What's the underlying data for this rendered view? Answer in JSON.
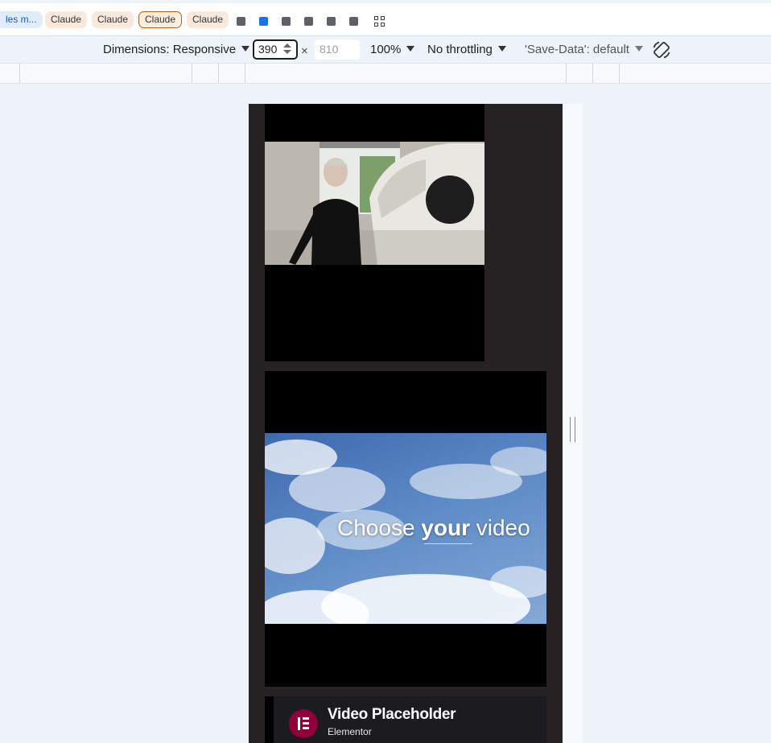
{
  "tabbar": {
    "chips": [
      {
        "label": "les m...",
        "style": "blue"
      },
      {
        "label": "Claude",
        "style": "peach"
      },
      {
        "label": "Claude",
        "style": "peach"
      },
      {
        "label": "Claude",
        "style": "outlined"
      },
      {
        "label": "Claude",
        "style": "peach"
      }
    ],
    "grid_icon": "apps-grid-icon"
  },
  "device_toolbar": {
    "dimensions_label": "Dimensions: Responsive",
    "width_value": "390",
    "times": "×",
    "height_placeholder": "810",
    "zoom": "100%",
    "throttling": "No throttling",
    "save_data": "'Save-Data': default",
    "rotate_icon": "rotate-icon"
  },
  "page": {
    "video_text_prefix": "Choose ",
    "video_text_bold": "your",
    "video_text_suffix": " video",
    "placeholder_title": "Video Placeholder",
    "placeholder_subtitle": "Elementor"
  },
  "colors": {
    "accent_blue": "#1a73e8",
    "elementor_brand": "#92003b",
    "viewport_bg": "#262223"
  }
}
